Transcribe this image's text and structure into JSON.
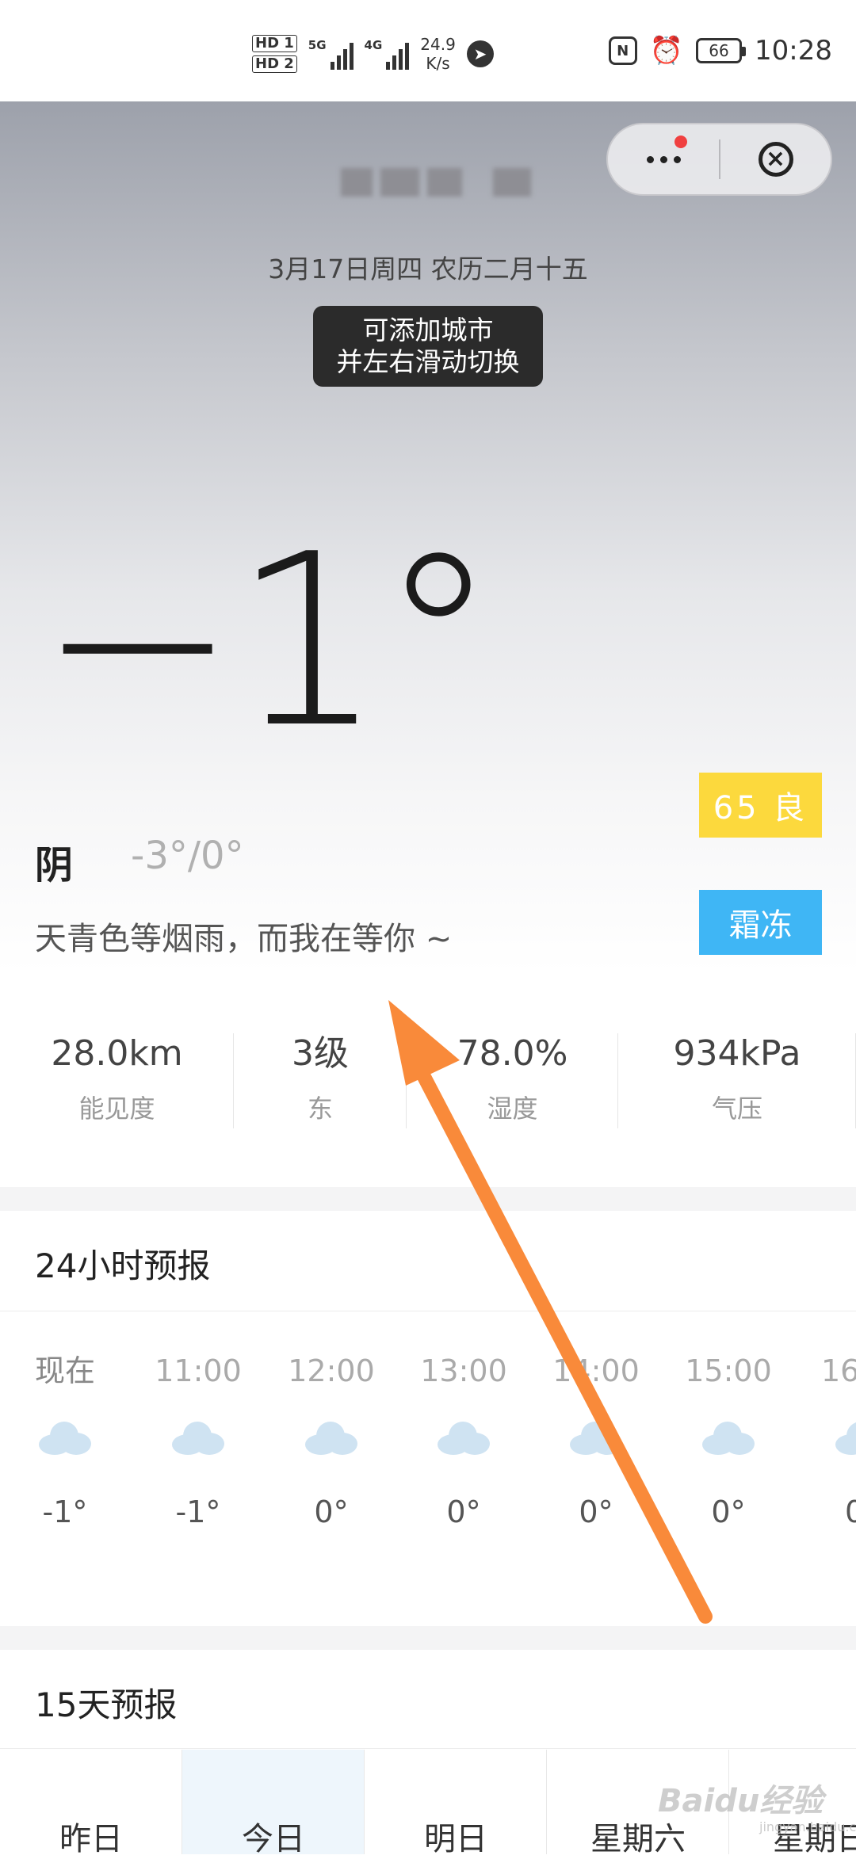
{
  "status_bar": {
    "hd1": "HD 1",
    "hd2": "HD 2",
    "net1": "5G",
    "net2": "4G",
    "speed_value": "24.9",
    "speed_unit": "K/s",
    "nfc_label": "N",
    "battery": "66",
    "time": "10:28"
  },
  "capsule": {
    "more_icon": "more-icon",
    "close_icon": "close-circle-icon"
  },
  "header": {
    "date": "3月17日周四 农历二月十五",
    "tooltip_line1": "可添加城市",
    "tooltip_line2": "并左右滑动切换"
  },
  "current": {
    "temperature": "−1°",
    "aqi": "65 良",
    "warning": "霜冻",
    "condition": "阴",
    "range": "-3°/0°",
    "quote": "天青色等烟雨，而我在等你 ~"
  },
  "stats": [
    {
      "value": "28.0km",
      "label": "能见度"
    },
    {
      "value": "3级",
      "label": "东"
    },
    {
      "value": "78.0%",
      "label": "湿度"
    },
    {
      "value": "934kPa",
      "label": "气压"
    }
  ],
  "hourly": {
    "title": "24小时预报",
    "items": [
      {
        "time": "现在",
        "temp": "-1°",
        "icon": "cloud-icon"
      },
      {
        "time": "11:00",
        "temp": "-1°",
        "icon": "cloud-icon"
      },
      {
        "time": "12:00",
        "temp": "0°",
        "icon": "cloud-icon"
      },
      {
        "time": "13:00",
        "temp": "0°",
        "icon": "cloud-icon"
      },
      {
        "time": "14:00",
        "temp": "0°",
        "icon": "cloud-icon"
      },
      {
        "time": "15:00",
        "temp": "0°",
        "icon": "cloud-icon"
      },
      {
        "time": "16",
        "temp": "0",
        "icon": "cloud-icon"
      }
    ]
  },
  "daily": {
    "title": "15天预报",
    "tabs": [
      "昨日",
      "今日",
      "明日",
      "星期六",
      "星期日"
    ]
  },
  "watermark": {
    "text": "Baidu经验",
    "sub": "jingyan.baidu.com"
  },
  "colors": {
    "aqi_bg": "#fcd93d",
    "warning_bg": "#3fb6f5",
    "arrow": "#f98a3a",
    "selected_tab_bg": "#eef6fc"
  }
}
